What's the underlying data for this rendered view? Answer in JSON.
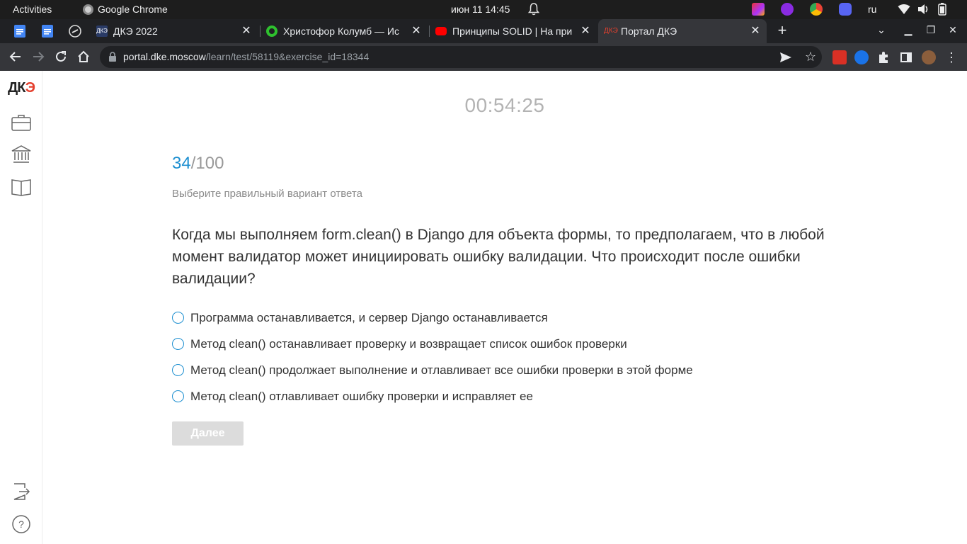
{
  "system_bar": {
    "activities": "Activities",
    "app_name": "Google Chrome",
    "datetime": "июн 11  14:45",
    "keyboard_layout": "ru"
  },
  "tabs": [
    {
      "title": "ДКЭ 2022",
      "favicon": "dke-2022-favicon",
      "active": false
    },
    {
      "title": "Христофор Колумб — Ис",
      "favicon": "green-ring-favicon",
      "active": false
    },
    {
      "title": "Принципы SOLID | На при",
      "favicon": "youtube-favicon",
      "active": false
    },
    {
      "title": "Портал ДКЭ",
      "favicon": "dke-portal-favicon",
      "active": true
    }
  ],
  "address_bar": {
    "host": "portal.dke.moscow",
    "path": "/learn/test/58119&exercise_id=18344"
  },
  "sidebar": {
    "logo_part1": "ДК",
    "logo_part2": "Э"
  },
  "test": {
    "timer": "00:54:25",
    "current": "34",
    "total": "/100",
    "instruction": "Выберите правильный вариант ответа",
    "question": "Когда мы выполняем form.clean() в Django для объекта формы, то предполагаем, что в любой момент валидатор может инициировать ошибку валидации. Что происходит после ошибки валидации?",
    "options": [
      "Программа останавливается, и сервер Django останавливается",
      "Метод clean() останавливает проверку и возвращает список ошибок проверки",
      "Метод clean() продолжает выполнение и отлавливает все ошибки проверки в этой форме",
      "Метод clean() отлавливает ошибку проверки и исправляет ее"
    ],
    "next_label": "Далее"
  },
  "colors": {
    "accent": "#1d8fd0",
    "button_disabled": "#dcdcdc",
    "timer": "#b3b3b3"
  }
}
